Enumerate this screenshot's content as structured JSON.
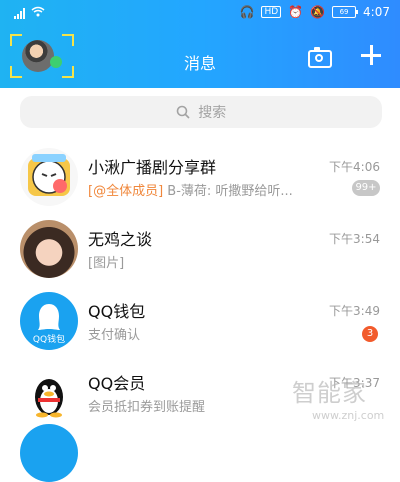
{
  "status_bar": {
    "time": "4:07",
    "battery": "69"
  },
  "header": {
    "title": "消息"
  },
  "search": {
    "placeholder": "搜索"
  },
  "conversations": [
    {
      "name": "小湫广播剧分享群",
      "time": "下午4:06",
      "mention": "[@全体成员]",
      "message": " B-薄荷: 听撒野给听...",
      "badge": "99+"
    },
    {
      "name": "无鸡之谈",
      "time": "下午3:54",
      "message": "[图片]"
    },
    {
      "name": "QQ钱包",
      "time": "下午3:49",
      "message": "支付确认",
      "badge": "3",
      "avatar_text": "QQ钱包"
    },
    {
      "name": "QQ会员",
      "time": "下午3:37",
      "message": "会员抵扣券到账提醒"
    }
  ],
  "watermark": {
    "text": "智能家",
    "url": "www.znj.com"
  },
  "colors": {
    "header_gradient_start": "#1fb3f2",
    "header_gradient_end": "#2f8cff",
    "badge_red": "#f25b2c",
    "badge_gray": "#c7c7c7",
    "mention_orange": "#f0873b"
  }
}
